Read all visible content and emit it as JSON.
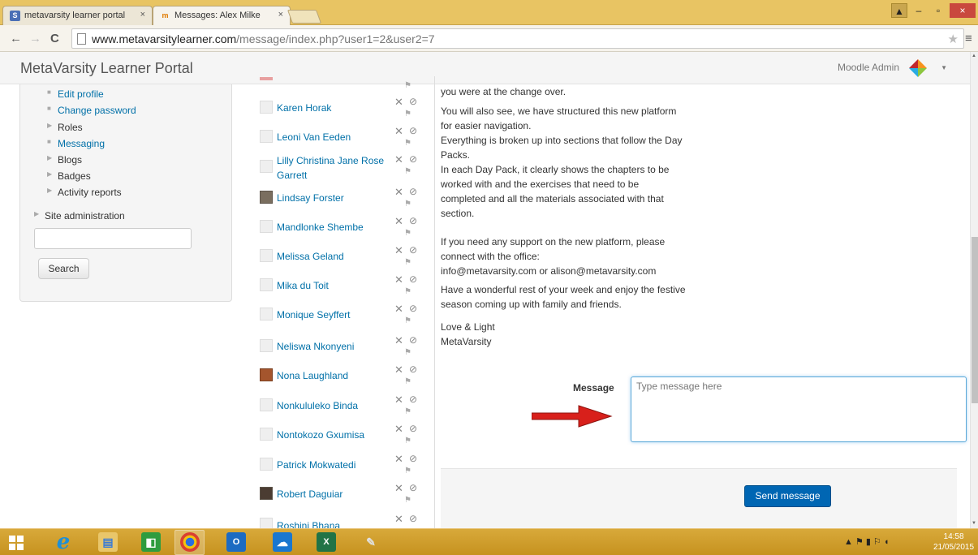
{
  "browser": {
    "tabs": [
      {
        "label": "metavarsity learner portal",
        "favicon": "S",
        "active": false
      },
      {
        "label": "Messages: Alex Milke",
        "favicon": "m",
        "active": true
      }
    ],
    "url_host": "www.metavarsitylearner.com",
    "url_path": "/message/index.php?user1=2&user2=7"
  },
  "header": {
    "site_name": "MetaVarsity Learner Portal",
    "user_name": "Moodle Admin"
  },
  "sidebar": {
    "items": [
      {
        "label": "Edit profile",
        "bullet": "■",
        "link": true
      },
      {
        "label": "Change password",
        "bullet": "■",
        "link": true
      },
      {
        "label": "Roles",
        "bullet": "▶",
        "link": false
      },
      {
        "label": "Messaging",
        "bullet": "■",
        "link": true
      },
      {
        "label": "Blogs",
        "bullet": "▶",
        "link": false
      },
      {
        "label": "Badges",
        "bullet": "▶",
        "link": false
      },
      {
        "label": "Activity reports",
        "bullet": "▶",
        "link": false
      }
    ],
    "site_admin": "Site administration",
    "search_value": "",
    "search_button": "Search"
  },
  "contacts": [
    {
      "name": "Karen Horak",
      "photo": false
    },
    {
      "name": "Leoni Van Eeden",
      "photo": false
    },
    {
      "name": "Lilly Christina Jane Rose Garrett",
      "photo": false
    },
    {
      "name": "Lindsay Forster",
      "photo": true
    },
    {
      "name": "Mandlonke Shembe",
      "photo": false
    },
    {
      "name": "Melissa Geland",
      "photo": false
    },
    {
      "name": "Mika du Toit",
      "photo": false
    },
    {
      "name": "Monique Seyffert",
      "photo": false
    },
    {
      "name": "Neliswa Nkonyeni",
      "photo": false
    },
    {
      "name": "Nona Laughland",
      "photo": true
    },
    {
      "name": "Nonkululeko Binda",
      "photo": false
    },
    {
      "name": "Nontokozo Gxumisa",
      "photo": false
    },
    {
      "name": "Patrick Mokwatedi",
      "photo": false
    },
    {
      "name": "Robert Daguiar",
      "photo": true
    },
    {
      "name": "Roshini Bhana",
      "photo": false
    }
  ],
  "message": {
    "paragraphs": [
      "you were at the change over.",
      "You will also see, we have structured this new platform\nfor easier navigation.\nEverything is broken up into sections that follow the Day\nPacks.\nIn each Day Pack, it clearly shows the chapters to be\nworked with and the exercises that need to be\ncompleted and all the materials associated with that\nsection.",
      "If you need any support on the new platform, please\nconnect with the office:\ninfo@metavarsity.com or alison@metavarsity.com",
      "Have a wonderful rest of your week and enjoy the festive\nseason coming up with family and friends.",
      "Love & Light\nMetaVarsity"
    ]
  },
  "form": {
    "label": "Message",
    "placeholder": "Type message here",
    "value": "",
    "send_button": "Send message"
  },
  "taskbar": {
    "time": "14:58",
    "date": "21/05/2015"
  },
  "colors": {
    "link": "#0070a8",
    "send_button": "#0066b3",
    "arrow": "#d8201b",
    "taskbar": "#c6921f"
  }
}
